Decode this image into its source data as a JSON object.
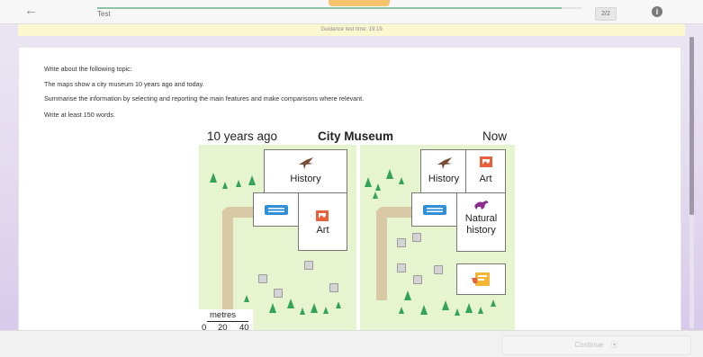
{
  "header": {
    "back_icon": "←",
    "title": "Test",
    "progress_fraction": 0.96,
    "counter": "2/2",
    "info_icon": "i"
  },
  "guidance": {
    "text": "Guidance test time: 19:19"
  },
  "task": {
    "line1": "Write about the following topic:",
    "line2": "The maps show a city museum 10 years ago and today.",
    "line3": "Summarise the information by selecting and reporting the main features and make comparisons where relevant.",
    "line4": "Write at least 150 words."
  },
  "figure": {
    "left_title": "10 years ago",
    "center_title": "City Museum",
    "right_title": "Now",
    "past": {
      "history": "History",
      "art": "Art"
    },
    "now": {
      "history": "History",
      "art": "Art",
      "natural_line1": "Natural",
      "natural_line2": "history"
    },
    "scale": {
      "label": "metres",
      "ticks": [
        "0",
        "20",
        "40"
      ]
    },
    "icons": [
      "pterodactyl-icon",
      "ticket-icon",
      "painting-icon",
      "dinosaur-icon",
      "cafe-icon",
      "tree-icon",
      "stone-icon"
    ],
    "colors": {
      "grass": "#e6f5cf",
      "tree": "#33a457",
      "path": "#d9c9a7",
      "ticket": "#2e8fd6",
      "art": "#e8603c",
      "dino": "#8b2c8f"
    }
  },
  "footer": {
    "continue_label": "Continue",
    "continue_icon": "⦿"
  }
}
